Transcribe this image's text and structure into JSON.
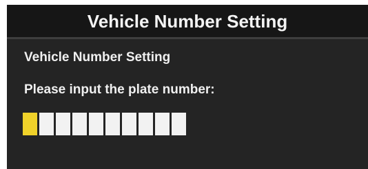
{
  "window": {
    "title": "Vehicle Number Setting"
  },
  "form": {
    "subtitle": "Vehicle Number Setting",
    "prompt": "Please input the plate number:",
    "plate_value": "",
    "plate_slots": 10,
    "cursor_index": 0
  },
  "colors": {
    "background": "#242424",
    "title_background": "#161616",
    "text": "#f0f0f0",
    "slot_empty": "#f2f2f2",
    "slot_cursor": "#f0d22a"
  }
}
